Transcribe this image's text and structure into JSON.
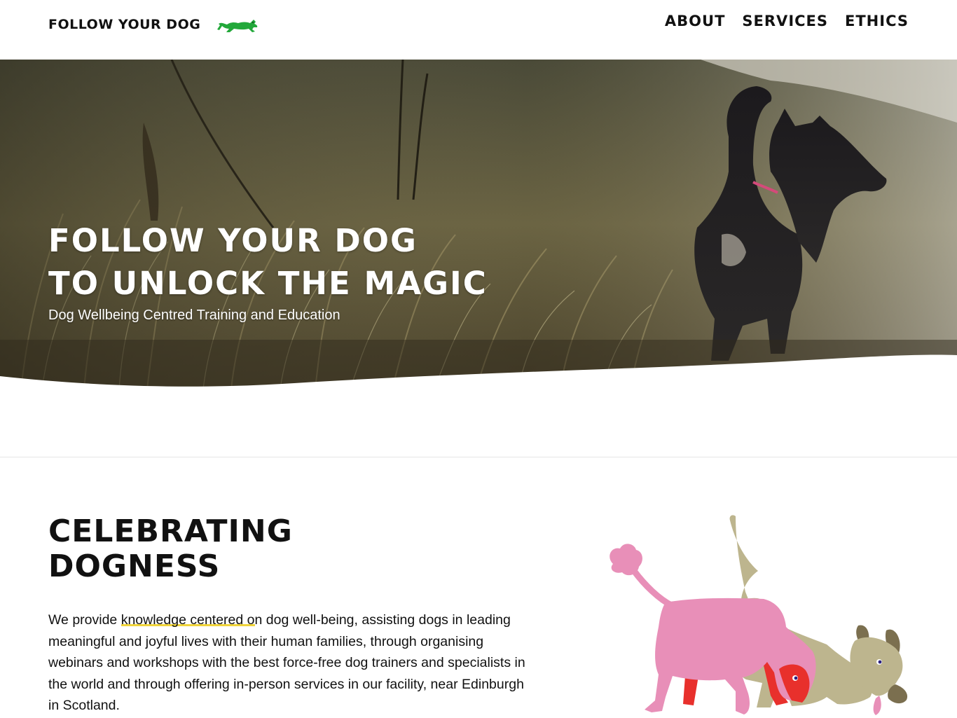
{
  "header": {
    "brand": "FOLLOW YOUR DOG",
    "logo_icon": "running-dog-icon",
    "nav": [
      {
        "label": "ABOUT"
      },
      {
        "label": "SERVICES"
      },
      {
        "label": "ETHICS"
      }
    ]
  },
  "hero": {
    "title_line1": "FOLLOW YOUR DOG",
    "title_line2": "TO UNLOCK THE MAGIC",
    "subtitle": "Dog Wellbeing Centred Training and Education"
  },
  "section": {
    "title_line1": "CELEBRATING",
    "title_line2": "DOGNESS",
    "body_part1": "We provide ",
    "body_highlight": "knowledge centered o",
    "body_part2": "n dog well-being, assisting dogs in leading meaningful and joyful lives with their human families, through organising webinars and workshops with the best force-free dog trainers and specialists in the world and through offering in-person services in our facility, near Edinburgh in Scotland."
  },
  "colors": {
    "logo_green": "#22a83a",
    "highlight_yellow": "#f0d43a",
    "dog_pink": "#e88fb8",
    "dog_red": "#e8302c",
    "dog_beige": "#bdb58e",
    "dog_ears": "#7b6f4f"
  }
}
